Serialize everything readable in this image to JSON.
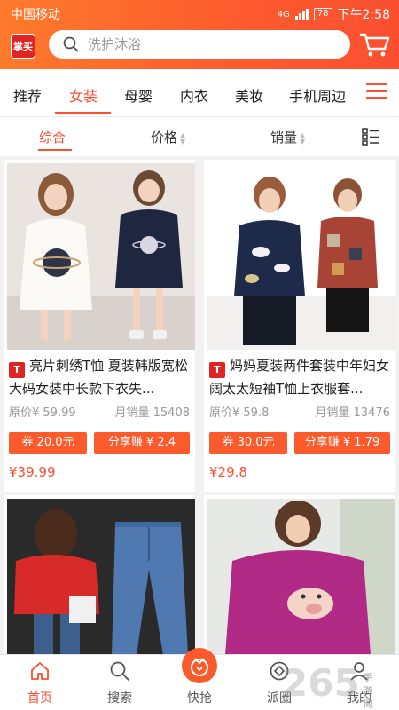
{
  "status_bar": {
    "carrier": "中国移动",
    "network": "4G",
    "battery": "78",
    "time": "下午2:58"
  },
  "header": {
    "logo_text": "掌买",
    "search_placeholder": "洗护沐浴"
  },
  "categories": [
    {
      "label": "推荐"
    },
    {
      "label": "女装"
    },
    {
      "label": "母婴"
    },
    {
      "label": "内衣"
    },
    {
      "label": "美妆"
    },
    {
      "label": "手机周边"
    }
  ],
  "active_category": "女装",
  "sort": {
    "overall": "综合",
    "price": "价格",
    "sales": "销量"
  },
  "products": [
    {
      "title": "亮片刺绣T恤 夏装韩版宽松大码女装中长款下衣失...",
      "orig_price": "原价¥ 59.99",
      "monthly_sales": "月销量 15408",
      "coupon": "券 20.0元",
      "share": "分享赚 ¥ 2.4",
      "price": "¥39.99"
    },
    {
      "title": "妈妈夏装两件套装中年妇女阔太太短袖T恤上衣服套...",
      "orig_price": "原价¥ 59.8",
      "monthly_sales": "月销量 13476",
      "coupon": "券 30.0元",
      "share": "分享赚 ¥ 1.79",
      "price": "¥29.8"
    },
    {
      "title": "",
      "orig_price": "",
      "monthly_sales": "",
      "coupon": "",
      "share": "",
      "price": ""
    },
    {
      "title": "",
      "orig_price": "",
      "monthly_sales": "",
      "coupon": "",
      "share": "",
      "price": ""
    }
  ],
  "bottom_nav": [
    {
      "label": "首页",
      "icon": "home-icon"
    },
    {
      "label": "搜索",
      "icon": "search-icon"
    },
    {
      "label": "快抢",
      "icon": "flash-sale-icon"
    },
    {
      "label": "派圈",
      "icon": "circle-icon"
    },
    {
      "label": "我的",
      "icon": "user-icon"
    }
  ],
  "watermark": "265",
  "watermark_small": "手游网",
  "colors": {
    "accent": "#fb4f30",
    "header_start": "#fe7a2c",
    "header_end": "#fb4f30",
    "button": "#fb5a2c"
  }
}
